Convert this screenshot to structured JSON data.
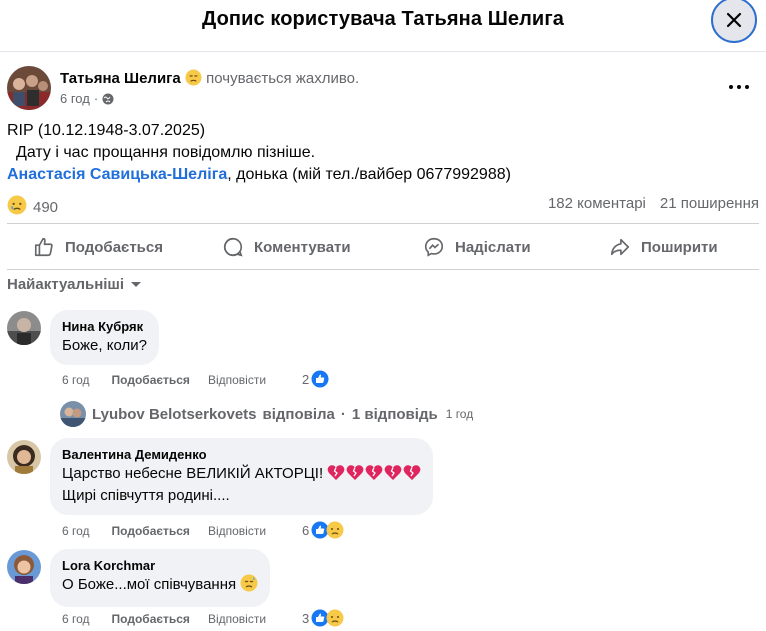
{
  "header": {
    "title": "Допис користувача Татьяна Шелига"
  },
  "post": {
    "author": "Татьяна Шелига",
    "feeling": "почувається жахливо.",
    "time": "6 год",
    "body_line1": "RIP (10.12.1948-3.07.2025)",
    "body_line2": "Дату і час прощання повідомлю пізніше.",
    "body_link": "Анастасія Савицька-Шеліга",
    "body_line3_rest": ", донька (мій тел./вайбер 0677992988)",
    "reaction_count": "490",
    "comments_count": "182 коментарі",
    "shares_count": "21 поширення"
  },
  "actions": {
    "like": "Подобається",
    "comment": "Коментувати",
    "send": "Надіслати",
    "share": "Поширити"
  },
  "sort": {
    "label": "Найактуальніші"
  },
  "comments": [
    {
      "name": "Нина Кубряк",
      "line1": "Боже, коли?",
      "time": "6 год",
      "like": "Подобається",
      "reply": "Відповісти",
      "reactions": "2"
    },
    {
      "name": "Валентина Демиденко",
      "line1": "Царство небесне ВЕЛИКІЙ АКТОРЦІ!",
      "line2": "Щирі співчуття родині....",
      "time": "6 год",
      "like": "Подобається",
      "reply": "Відповісти",
      "reactions": "6"
    },
    {
      "name": "Lora Korchmar",
      "line1": "О Боже...мої співчування",
      "time": "6 год",
      "like": "Подобається",
      "reply": "Відповісти",
      "reactions": "3"
    }
  ],
  "reply_summary": {
    "name": "Lyubov Belotserkovets",
    "text": "відповіла",
    "separator": "·",
    "count": "1 відповідь",
    "time": "1 год"
  },
  "colors": {
    "link_blue": "#216fdb",
    "like_blue": "#1877f2",
    "muted": "#65676b",
    "bubble": "#f0f2f5",
    "heart_red": "#e0245e"
  },
  "icons": [
    "close-icon",
    "globe-icon",
    "more-icon",
    "thumbs-up-icon",
    "comment-icon",
    "messenger-icon",
    "share-icon",
    "chevron-down-icon",
    "sad-emoji-icon",
    "broken-heart-icon",
    "like-reaction-icon"
  ]
}
